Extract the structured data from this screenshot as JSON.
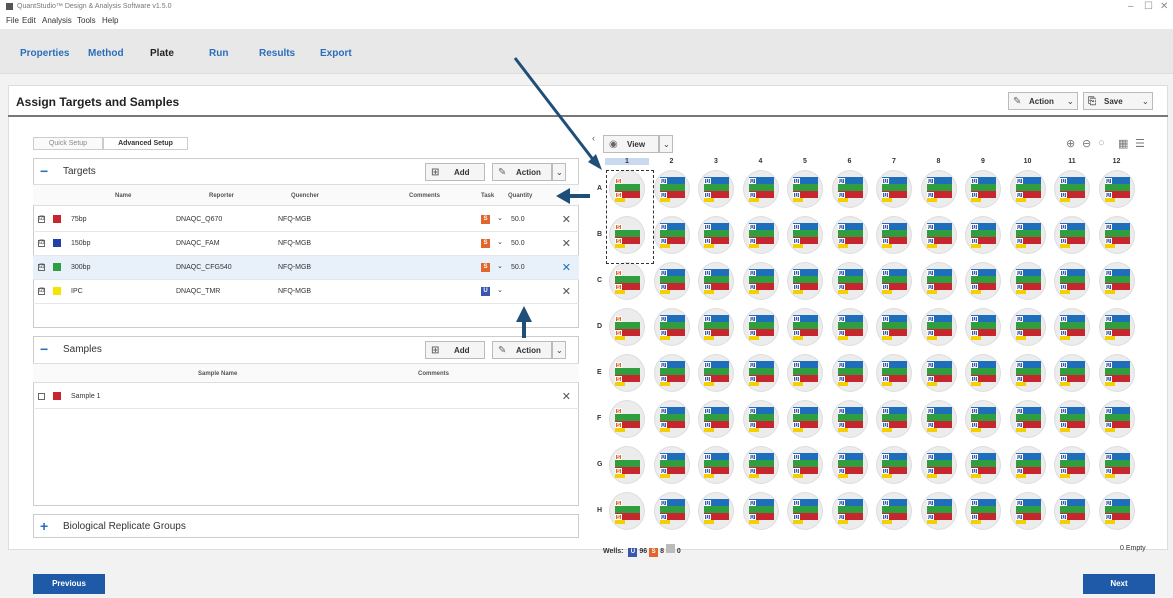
{
  "window": {
    "title": "QuantStudio™ Design & Analysis Software v1.5.0",
    "controls": [
      "–",
      "☐",
      "✕"
    ]
  },
  "menu": [
    "File",
    "Edit",
    "Analysis",
    "Tools",
    "Help"
  ],
  "nav_tabs": [
    {
      "label": "Properties"
    },
    {
      "label": "Method"
    },
    {
      "label": "Plate",
      "active": true
    },
    {
      "label": "Run"
    },
    {
      "label": "Results"
    },
    {
      "label": "Export"
    }
  ],
  "page": {
    "title": "Assign Targets and Samples",
    "action_label": "Action",
    "save_label": "Save"
  },
  "setup_tabs": [
    "Quick Setup",
    "Advanced Setup"
  ],
  "targets": {
    "title": "Targets",
    "add_label": "Add",
    "action_label": "Action",
    "columns": [
      "Name",
      "Reporter",
      "Quencher",
      "Comments",
      "Task",
      "Quantity"
    ],
    "rows": [
      {
        "checked": "☑",
        "color": "#c8262e",
        "name": "75bp",
        "reporter": "DNAQC_Q670",
        "quencher": "NFQ-MGB",
        "comments": "",
        "task": "S",
        "task_color": "#e0662e",
        "arrow": "⌄",
        "quantity": "50.0"
      },
      {
        "checked": "☑",
        "color": "#2340a8",
        "name": "150bp",
        "reporter": "DNAQC_FAM",
        "quencher": "NFQ-MGB",
        "comments": "",
        "task": "S",
        "task_color": "#e0662e",
        "arrow": "⌄",
        "quantity": "50.0"
      },
      {
        "checked": "☑",
        "color": "#2e9e3e",
        "name": "300bp",
        "reporter": "DNAQC_CFG540",
        "quencher": "NFQ-MGB",
        "comments": "",
        "task": "S",
        "task_color": "#e0662e",
        "arrow": "⌄",
        "quantity": "50.0"
      },
      {
        "checked": "☑",
        "color": "#f5e300",
        "name": "IPC",
        "reporter": "DNAQC_TMR",
        "quencher": "NFQ-MGB",
        "comments": "",
        "task": "U",
        "task_color": "#3a56b0",
        "arrow": "⌄",
        "quantity": ""
      }
    ]
  },
  "samples": {
    "title": "Samples",
    "add_label": "Add",
    "action_label": "Action",
    "columns": [
      "Sample Name",
      "Comments"
    ],
    "rows": [
      {
        "checked": "☐",
        "color": "#c8262e",
        "name": "Sample 1",
        "comments": ""
      }
    ]
  },
  "bio_groups": {
    "title": "Biological Replicate Groups"
  },
  "plate": {
    "view_label": "View",
    "columns": [
      "1",
      "2",
      "3",
      "4",
      "5",
      "6",
      "7",
      "8",
      "9",
      "10",
      "11",
      "12"
    ],
    "rows": [
      "A",
      "B",
      "C",
      "D",
      "E",
      "F",
      "G",
      "H"
    ],
    "standard_tag": "S",
    "unknown_tag": "U",
    "wells_summary": {
      "label": "Wells:",
      "unknown_icon": "U",
      "unknown_count": "96",
      "standard_icon": "S",
      "standard_count": "8",
      "empty_count": "0"
    },
    "empty_label": "0 Empty"
  },
  "footer": {
    "previous": "Previous",
    "next": "Next"
  },
  "colors": {
    "accent": "#1e5aa8",
    "arrow": "#1f4e79"
  }
}
